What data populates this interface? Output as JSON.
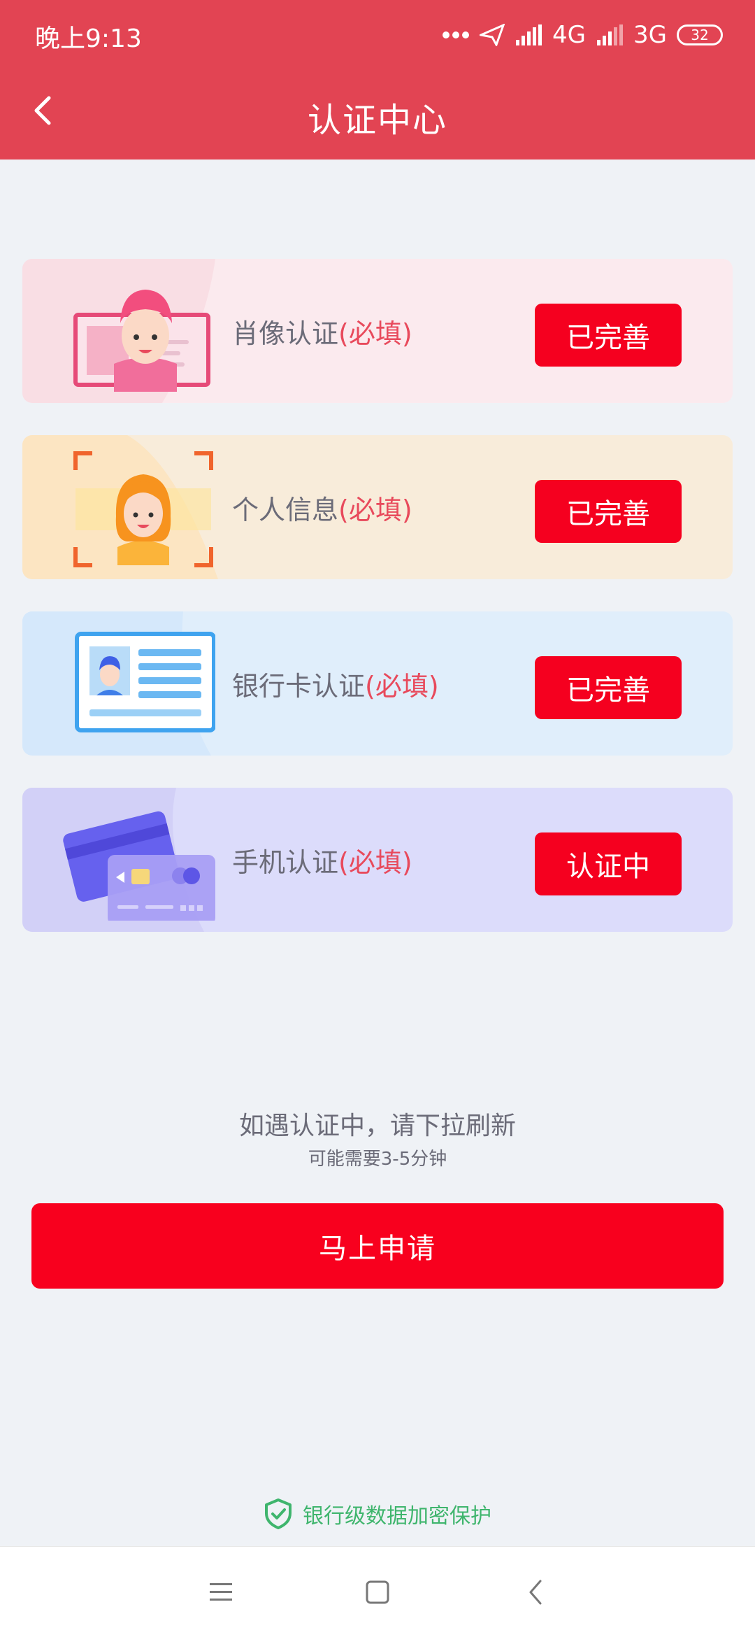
{
  "status_bar": {
    "time": "晚上9:13",
    "network_1": "4G",
    "network_2": "3G",
    "battery": "32"
  },
  "header": {
    "title": "认证中心"
  },
  "cards": [
    {
      "label": "肖像认证",
      "required": "(必填)",
      "status": "已完善",
      "icon": "portrait-icon",
      "bg": "#fbeaee",
      "corner": "#f9e0e6"
    },
    {
      "label": "个人信息",
      "required": "(必填)",
      "status": "已完善",
      "icon": "personal-info-icon",
      "bg": "#f8ecda",
      "corner": "#fbe7c8"
    },
    {
      "label": "银行卡认证",
      "required": "(必填)",
      "status": "已完善",
      "icon": "bank-card-icon",
      "bg": "#e0eefb",
      "corner": "#d4e8fa"
    },
    {
      "label": "手机认证",
      "required": "(必填)",
      "status": "认证中",
      "icon": "phone-card-icon",
      "bg": "#dcdcfb",
      "corner": "#d2d1f8"
    }
  ],
  "tip": {
    "title": "如遇认证中，请下拉刷新",
    "subtitle": "可能需要3-5分钟"
  },
  "apply_button": "马上申请",
  "security_text": "银行级数据加密保护",
  "colors": {
    "header": "#e24453",
    "primary_button": "#f5001f",
    "required_text": "#e84a5c",
    "security_green": "#3fb56d"
  }
}
